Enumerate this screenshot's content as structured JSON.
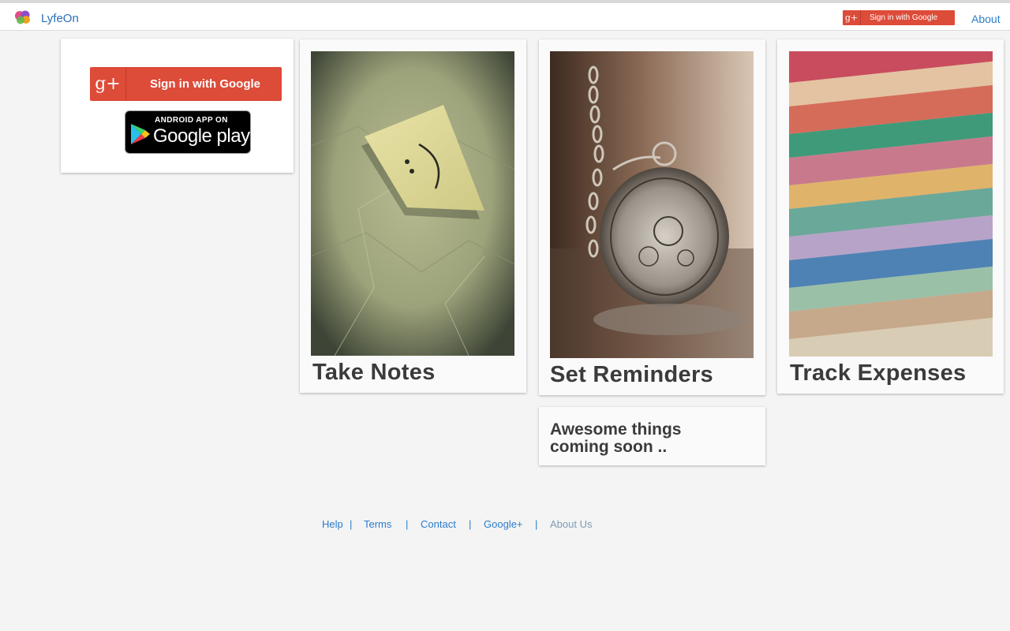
{
  "header": {
    "brand": "LyfeOn",
    "signin_label": "Sign in with Google",
    "signin_icon": "g+",
    "about_label": "About"
  },
  "signin_card": {
    "google_signin_label": "Sign in with Google",
    "google_signin_icon": "g+",
    "play_badge_top": "ANDROID APP ON",
    "play_badge_main": "Google play"
  },
  "features": [
    {
      "title": "Take Notes",
      "image": "crumpled-paper-smiley-note"
    },
    {
      "title": "Set Reminders",
      "image": "pocket-watch-on-chain"
    },
    {
      "title": "Track Expenses",
      "image": "stack-of-banknotes"
    }
  ],
  "coming_soon": "Awesome things coming soon ..",
  "footer": {
    "links": [
      "Help",
      "Terms",
      "Contact",
      "Google+",
      "About Us"
    ],
    "separator": "|"
  },
  "colors": {
    "google_red": "#dd4b39",
    "link_blue": "#2a7ccc",
    "page_bg": "#f4f4f4",
    "title_text": "#3b3b3b"
  }
}
